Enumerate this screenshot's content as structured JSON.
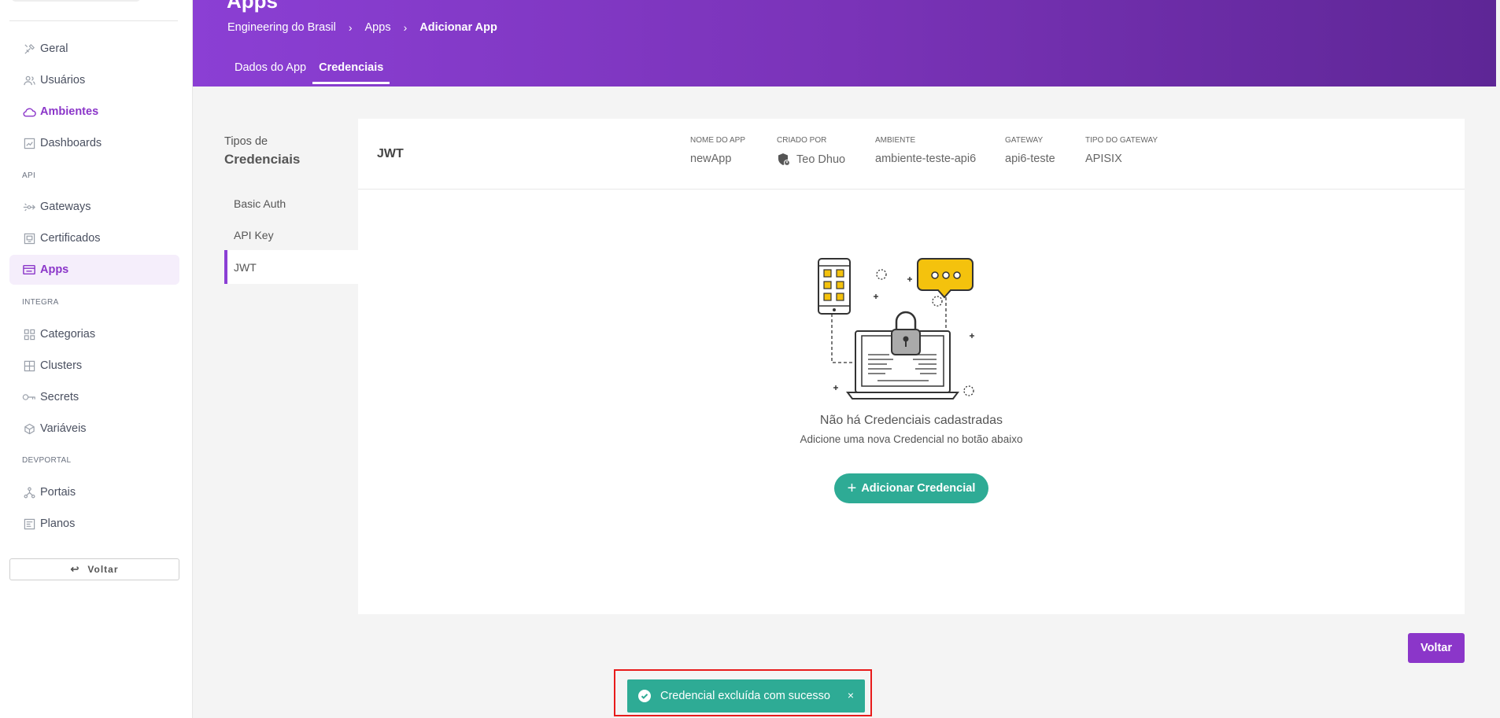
{
  "sidebar": {
    "items": [
      {
        "label": "Geral",
        "icon": "tools-icon"
      },
      {
        "label": "Usuários",
        "icon": "users-icon"
      },
      {
        "label": "Ambientes",
        "icon": "cloud-icon"
      },
      {
        "label": "Dashboards",
        "icon": "dashboard-icon"
      },
      {
        "label": "Gateways",
        "icon": "gateway-icon"
      },
      {
        "label": "Certificados",
        "icon": "certificate-icon"
      },
      {
        "label": "Apps",
        "icon": "apps-icon"
      },
      {
        "label": "Categorias",
        "icon": "categories-icon"
      },
      {
        "label": "Clusters",
        "icon": "clusters-icon"
      },
      {
        "label": "Secrets",
        "icon": "key-icon"
      },
      {
        "label": "Variáveis",
        "icon": "variables-icon"
      },
      {
        "label": "Portais",
        "icon": "portals-icon"
      },
      {
        "label": "Planos",
        "icon": "plans-icon"
      }
    ],
    "sections": {
      "api": "API",
      "integra": "INTEGRA",
      "devportal": "DEVPORTAL"
    },
    "back_label": "Voltar"
  },
  "header": {
    "title": "Apps",
    "breadcrumb": [
      "Engineering do Brasil",
      "Apps",
      "Adicionar App"
    ],
    "tabs": [
      "Dados do App",
      "Credenciais"
    ]
  },
  "credentials": {
    "side_title_1": "Tipos de",
    "side_title_2": "Credenciais",
    "types": [
      "Basic Auth",
      "API Key",
      "JWT"
    ],
    "selected_type": "JWT"
  },
  "panel": {
    "heading": "JWT",
    "meta": [
      {
        "label": "NOME DO APP",
        "value": "newApp"
      },
      {
        "label": "CRIADO POR",
        "value": "Teo Dhuo"
      },
      {
        "label": "AMBIENTE",
        "value": "ambiente-teste-api6"
      },
      {
        "label": "GATEWAY",
        "value": "api6-teste"
      },
      {
        "label": "TIPO DO GATEWAY",
        "value": "APISIX"
      }
    ],
    "empty_title": "Não há Credenciais cadastradas",
    "empty_subtitle": "Adicione uma nova Credencial no botão abaixo",
    "add_button": "Adicionar Credencial"
  },
  "footer": {
    "voltar": "Voltar"
  },
  "toast": {
    "message": "Credencial excluída com sucesso",
    "close": "×"
  },
  "colors": {
    "primary": "#8b36c9",
    "success": "#2eab95",
    "highlight": "#e81b1b"
  }
}
